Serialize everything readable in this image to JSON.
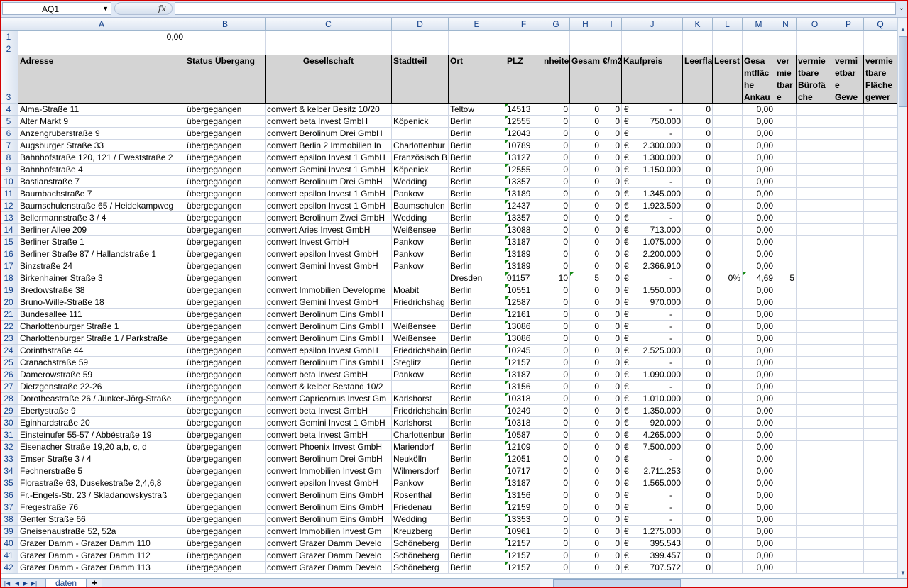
{
  "formula_bar": {
    "name_box": "AQ1",
    "fx": "fx",
    "formula": ""
  },
  "columns": [
    "A",
    "B",
    "C",
    "D",
    "E",
    "F",
    "G",
    "H",
    "I",
    "J",
    "K",
    "L",
    "M",
    "N",
    "O",
    "P",
    "Q"
  ],
  "row1_value": "0,00",
  "headers": {
    "A": "Adresse",
    "B": "Status Übergang",
    "C": "Gesellschaft",
    "D": "Stadtteil",
    "E": "Ort",
    "F": "PLZ",
    "G": "nheite",
    "H": "Gesam",
    "I": "€/m2",
    "J": "Kaufpreis",
    "K": "Leerfla",
    "L": "Leerst",
    "M": "Gesa mtfläc he Ankau",
    "N": "ver mie tbar e",
    "O": "vermie tbare Bürofä che",
    "P": "vermi etbar e Gewe",
    "Q": "vermie tbare Fläche gewer"
  },
  "euro_symbol": "€",
  "rows": [
    {
      "n": "4",
      "A": "Alma-Straße 11",
      "B": "übergegangen",
      "C": "conwert & kelber Besitz 10/20",
      "D": "",
      "E": "Teltow",
      "F": "14513",
      "G": "0",
      "H": "0",
      "I": "0",
      "J": "-",
      "K": "0",
      "L": "",
      "M": "0,00",
      "N": ""
    },
    {
      "n": "5",
      "A": "Alter Markt 9",
      "B": "übergegangen",
      "C": "conwert beta Invest GmbH",
      "D": "Köpenick",
      "E": "Berlin",
      "F": "12555",
      "G": "0",
      "H": "0",
      "I": "0",
      "J": "750.000",
      "K": "0",
      "L": "",
      "M": "0,00",
      "N": ""
    },
    {
      "n": "6",
      "A": "Anzengruberstraße 9",
      "B": "übergegangen",
      "C": "conwert Berolinum Drei GmbH",
      "D": "",
      "E": "Berlin",
      "F": "12043",
      "G": "0",
      "H": "0",
      "I": "0",
      "J": "-",
      "K": "0",
      "L": "",
      "M": "0,00",
      "N": ""
    },
    {
      "n": "7",
      "A": "Augsburger Straße 33",
      "B": "übergegangen",
      "C": "conwert Berlin 2 Immobilien In",
      "D": "Charlottenbur",
      "E": "Berlin",
      "F": "10789",
      "G": "0",
      "H": "0",
      "I": "0",
      "J": "2.300.000",
      "K": "0",
      "L": "",
      "M": "0,00",
      "N": ""
    },
    {
      "n": "8",
      "A": "Bahnhofstraße 120, 121 / Eweststraße 2",
      "B": "übergegangen",
      "C": "conwert epsilon Invest 1 GmbH",
      "D": "Französisch B",
      "E": "Berlin",
      "F": "13127",
      "G": "0",
      "H": "0",
      "I": "0",
      "J": "1.300.000",
      "K": "0",
      "L": "",
      "M": "0,00",
      "N": ""
    },
    {
      "n": "9",
      "A": "Bahnhofstraße 4",
      "B": "übergegangen",
      "C": "conwert Gemini Invest 1 GmbH",
      "D": "Köpenick",
      "E": "Berlin",
      "F": "12555",
      "G": "0",
      "H": "0",
      "I": "0",
      "J": "1.150.000",
      "K": "0",
      "L": "",
      "M": "0,00",
      "N": ""
    },
    {
      "n": "10",
      "A": "Bastianstraße 7",
      "B": "übergegangen",
      "C": "conwert Berolinum Drei GmbH",
      "D": "Wedding",
      "E": "Berlin",
      "F": "13357",
      "G": "0",
      "H": "0",
      "I": "0",
      "J": "-",
      "K": "0",
      "L": "",
      "M": "0,00",
      "N": ""
    },
    {
      "n": "11",
      "A": "Baumbachstraße 7",
      "B": "übergegangen",
      "C": "conwert epsilon Invest 1 GmbH",
      "D": "Pankow",
      "E": "Berlin",
      "F": "13189",
      "G": "0",
      "H": "0",
      "I": "0",
      "J": "1.345.000",
      "K": "0",
      "L": "",
      "M": "0,00",
      "N": ""
    },
    {
      "n": "12",
      "A": "Baumschulenstraße 65 / Heidekampweg",
      "B": "übergegangen",
      "C": "conwert epsilon Invest 1 GmbH",
      "D": "Baumschulen",
      "E": "Berlin",
      "F": "12437",
      "G": "0",
      "H": "0",
      "I": "0",
      "J": "1.923.500",
      "K": "0",
      "L": "",
      "M": "0,00",
      "N": ""
    },
    {
      "n": "13",
      "A": "Bellermannstraße 3 / 4",
      "B": "übergegangen",
      "C": "conwert Berolinum Zwei GmbH",
      "D": "Wedding",
      "E": "Berlin",
      "F": "13357",
      "G": "0",
      "H": "0",
      "I": "0",
      "J": "-",
      "K": "0",
      "L": "",
      "M": "0,00",
      "N": ""
    },
    {
      "n": "14",
      "A": "Berliner Allee 209",
      "B": "übergegangen",
      "C": "conwert Aries Invest GmbH",
      "D": "Weißensee",
      "E": "Berlin",
      "F": "13088",
      "G": "0",
      "H": "0",
      "I": "0",
      "J": "713.000",
      "K": "0",
      "L": "",
      "M": "0,00",
      "N": ""
    },
    {
      "n": "15",
      "A": "Berliner Straße 1",
      "B": "übergegangen",
      "C": "conwert Invest GmbH",
      "D": "Pankow",
      "E": "Berlin",
      "F": "13187",
      "G": "0",
      "H": "0",
      "I": "0",
      "J": "1.075.000",
      "K": "0",
      "L": "",
      "M": "0,00",
      "N": ""
    },
    {
      "n": "16",
      "A": "Berliner Straße 87 / Hallandstraße 1",
      "B": "übergegangen",
      "C": "conwert epsilon Invest GmbH",
      "D": "Pankow",
      "E": "Berlin",
      "F": "13189",
      "G": "0",
      "H": "0",
      "I": "0",
      "J": "2.200.000",
      "K": "0",
      "L": "",
      "M": "0,00",
      "N": ""
    },
    {
      "n": "17",
      "A": "Binzstraße 24",
      "B": "übergegangen",
      "C": "conwert Gemini Invest GmbH",
      "D": "Pankow",
      "E": "Berlin",
      "F": "13189",
      "G": "0",
      "H": "0",
      "I": "0",
      "J": "2.366.910",
      "K": "0",
      "L": "",
      "M": "0,00",
      "N": ""
    },
    {
      "n": "18",
      "A": "Birkenhainer Straße 3",
      "B": "übergegangen",
      "C": "conwert",
      "D": "",
      "E": "Dresden",
      "F": "01157",
      "G": "10",
      "H": "5",
      "I": "0",
      "J": "-",
      "K": "0",
      "L": "0%",
      "M": "4,69",
      "N": "5"
    },
    {
      "n": "19",
      "A": "Bredowstraße 38",
      "B": "übergegangen",
      "C": "conwert Immobilien Developme",
      "D": "Moabit",
      "E": "Berlin",
      "F": "10551",
      "G": "0",
      "H": "0",
      "I": "0",
      "J": "1.550.000",
      "K": "0",
      "L": "",
      "M": "0,00",
      "N": ""
    },
    {
      "n": "20",
      "A": "Bruno-Wille-Straße 18",
      "B": "übergegangen",
      "C": "conwert Gemini Invest GmbH",
      "D": "Friedrichshag",
      "E": "Berlin",
      "F": "12587",
      "G": "0",
      "H": "0",
      "I": "0",
      "J": "970.000",
      "K": "0",
      "L": "",
      "M": "0,00",
      "N": ""
    },
    {
      "n": "21",
      "A": "Bundesallee 111",
      "B": "übergegangen",
      "C": "conwert Berolinum Eins GmbH",
      "D": "",
      "E": "Berlin",
      "F": "12161",
      "G": "0",
      "H": "0",
      "I": "0",
      "J": "-",
      "K": "0",
      "L": "",
      "M": "0,00",
      "N": ""
    },
    {
      "n": "22",
      "A": "Charlottenburger Straße 1",
      "B": "übergegangen",
      "C": "conwert Berolinum Eins GmbH",
      "D": "Weißensee",
      "E": "Berlin",
      "F": "13086",
      "G": "0",
      "H": "0",
      "I": "0",
      "J": "-",
      "K": "0",
      "L": "",
      "M": "0,00",
      "N": ""
    },
    {
      "n": "23",
      "A": "Charlottenburger Straße 1 / Parkstraße",
      "B": "übergegangen",
      "C": "conwert Berolinum Eins GmbH",
      "D": "Weißensee",
      "E": "Berlin",
      "F": "13086",
      "G": "0",
      "H": "0",
      "I": "0",
      "J": "-",
      "K": "0",
      "L": "",
      "M": "0,00",
      "N": ""
    },
    {
      "n": "24",
      "A": "Corinthstraße 44",
      "B": "übergegangen",
      "C": "conwert epsilon Invest GmbH",
      "D": "Friedrichshain",
      "E": "Berlin",
      "F": "10245",
      "G": "0",
      "H": "0",
      "I": "0",
      "J": "2.525.000",
      "K": "0",
      "L": "",
      "M": "0,00",
      "N": ""
    },
    {
      "n": "25",
      "A": "Cranachstraße 59",
      "B": "übergegangen",
      "C": "conwert Berolinum Eins GmbH",
      "D": "Steglitz",
      "E": "Berlin",
      "F": "12157",
      "G": "0",
      "H": "0",
      "I": "0",
      "J": "-",
      "K": "0",
      "L": "",
      "M": "0,00",
      "N": ""
    },
    {
      "n": "26",
      "A": "Damerowstraße 59",
      "B": "übergegangen",
      "C": "conwert beta Invest GmbH",
      "D": "Pankow",
      "E": "Berlin",
      "F": "13187",
      "G": "0",
      "H": "0",
      "I": "0",
      "J": "1.090.000",
      "K": "0",
      "L": "",
      "M": "0,00",
      "N": ""
    },
    {
      "n": "27",
      "A": "Dietzgenstraße 22-26",
      "B": "übergegangen",
      "C": "conwert & kelber Bestand 10/2",
      "D": "",
      "E": "Berlin",
      "F": "13156",
      "G": "0",
      "H": "0",
      "I": "0",
      "J": "-",
      "K": "0",
      "L": "",
      "M": "0,00",
      "N": ""
    },
    {
      "n": "28",
      "A": "Dorotheastraße 26 / Junker-Jörg-Straße",
      "B": "übergegangen",
      "C": "conwert Capricornus Invest Gm",
      "D": "Karlshorst",
      "E": "Berlin",
      "F": "10318",
      "G": "0",
      "H": "0",
      "I": "0",
      "J": "1.010.000",
      "K": "0",
      "L": "",
      "M": "0,00",
      "N": ""
    },
    {
      "n": "29",
      "A": "Ebertystraße 9",
      "B": "übergegangen",
      "C": "conwert beta Invest GmbH",
      "D": "Friedrichshain",
      "E": "Berlin",
      "F": "10249",
      "G": "0",
      "H": "0",
      "I": "0",
      "J": "1.350.000",
      "K": "0",
      "L": "",
      "M": "0,00",
      "N": ""
    },
    {
      "n": "30",
      "A": "Eginhardstraße 20",
      "B": "übergegangen",
      "C": "conwert Gemini Invest 1 GmbH",
      "D": "Karlshorst",
      "E": "Berlin",
      "F": "10318",
      "G": "0",
      "H": "0",
      "I": "0",
      "J": "920.000",
      "K": "0",
      "L": "",
      "M": "0,00",
      "N": ""
    },
    {
      "n": "31",
      "A": "Einsteinufer 55-57 / Abbéstraße 19",
      "B": "übergegangen",
      "C": "conwert beta Invest GmbH",
      "D": "Charlottenbur",
      "E": "Berlin",
      "F": "10587",
      "G": "0",
      "H": "0",
      "I": "0",
      "J": "4.265.000",
      "K": "0",
      "L": "",
      "M": "0,00",
      "N": ""
    },
    {
      "n": "32",
      "A": "Eisenacher Straße 19,20 a,b, c, d",
      "B": "übergegangen",
      "C": "conwert Phoenix Invest GmbH",
      "D": "Mariendorf",
      "E": "Berlin",
      "F": "12109",
      "G": "0",
      "H": "0",
      "I": "0",
      "J": "7.500.000",
      "K": "0",
      "L": "",
      "M": "0,00",
      "N": ""
    },
    {
      "n": "33",
      "A": "Emser Straße 3 / 4",
      "B": "übergegangen",
      "C": "conwert Berolinum Drei GmbH",
      "D": "Neukölln",
      "E": "Berlin",
      "F": "12051",
      "G": "0",
      "H": "0",
      "I": "0",
      "J": "-",
      "K": "0",
      "L": "",
      "M": "0,00",
      "N": ""
    },
    {
      "n": "34",
      "A": "Fechnerstraße 5",
      "B": "übergegangen",
      "C": "conwert Immobilien Invest Gm",
      "D": "Wilmersdorf",
      "E": "Berlin",
      "F": "10717",
      "G": "0",
      "H": "0",
      "I": "0",
      "J": "2.711.253",
      "K": "0",
      "L": "",
      "M": "0,00",
      "N": ""
    },
    {
      "n": "35",
      "A": "Florastraße 63, Dusekestraße 2,4,6,8",
      "B": "übergegangen",
      "C": "conwert epsilon Invest GmbH",
      "D": "Pankow",
      "E": "Berlin",
      "F": "13187",
      "G": "0",
      "H": "0",
      "I": "0",
      "J": "1.565.000",
      "K": "0",
      "L": "",
      "M": "0,00",
      "N": ""
    },
    {
      "n": "36",
      "A": "Fr.-Engels-Str. 23 / Skladanowskystraß",
      "B": "übergegangen",
      "C": "conwert Berolinum Eins GmbH",
      "D": "Rosenthal",
      "E": "Berlin",
      "F": "13156",
      "G": "0",
      "H": "0",
      "I": "0",
      "J": "-",
      "K": "0",
      "L": "",
      "M": "0,00",
      "N": ""
    },
    {
      "n": "37",
      "A": "Fregestraße 76",
      "B": "übergegangen",
      "C": "conwert Berolinum Eins GmbH",
      "D": "Friedenau",
      "E": "Berlin",
      "F": "12159",
      "G": "0",
      "H": "0",
      "I": "0",
      "J": "-",
      "K": "0",
      "L": "",
      "M": "0,00",
      "N": ""
    },
    {
      "n": "38",
      "A": "Genter Straße 66",
      "B": "übergegangen",
      "C": "conwert Berolinum Eins GmbH",
      "D": "Wedding",
      "E": "Berlin",
      "F": "13353",
      "G": "0",
      "H": "0",
      "I": "0",
      "J": "-",
      "K": "0",
      "L": "",
      "M": "0,00",
      "N": ""
    },
    {
      "n": "39",
      "A": "Gneisenaustraße 52, 52a",
      "B": "übergegangen",
      "C": "conwert Immobilien Invest Gm",
      "D": "Kreuzberg",
      "E": "Berlin",
      "F": "10961",
      "G": "0",
      "H": "0",
      "I": "0",
      "J": "1.275.000",
      "K": "0",
      "L": "",
      "M": "0,00",
      "N": ""
    },
    {
      "n": "40",
      "A": "Grazer Damm - Grazer Damm 110",
      "B": "übergegangen",
      "C": "conwert Grazer Damm Develo",
      "D": "Schöneberg",
      "E": "Berlin",
      "F": "12157",
      "G": "0",
      "H": "0",
      "I": "0",
      "J": "395.543",
      "K": "0",
      "L": "",
      "M": "0,00",
      "N": ""
    },
    {
      "n": "41",
      "A": "Grazer Damm - Grazer Damm 112",
      "B": "übergegangen",
      "C": "conwert Grazer Damm Develo",
      "D": "Schöneberg",
      "E": "Berlin",
      "F": "12157",
      "G": "0",
      "H": "0",
      "I": "0",
      "J": "399.457",
      "K": "0",
      "L": "",
      "M": "0,00",
      "N": ""
    },
    {
      "n": "42",
      "A": "Grazer Damm - Grazer Damm 113",
      "B": "übergegangen",
      "C": "conwert Grazer Damm Develo",
      "D": "Schöneberg",
      "E": "Berlin",
      "F": "12157",
      "G": "0",
      "H": "0",
      "I": "0",
      "J": "707.572",
      "K": "0",
      "L": "",
      "M": "0,00",
      "N": ""
    }
  ],
  "sheet_tabs": [
    "daten"
  ]
}
